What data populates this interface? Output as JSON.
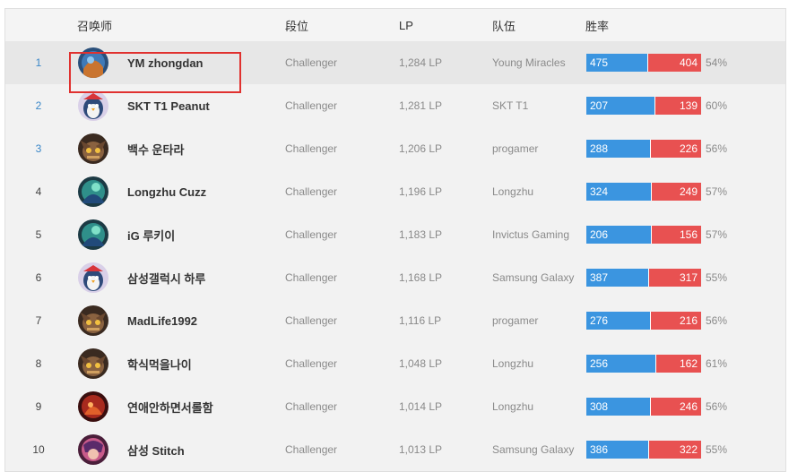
{
  "header": {
    "summoner": "召唤师",
    "tier": "段位",
    "lp": "LP",
    "team": "队伍",
    "winrate": "胜率"
  },
  "colors": {
    "win": "#3b95e0",
    "loss": "#e85151",
    "highlight": "#e0312f",
    "rank_link": "#3a87c8"
  },
  "rows": [
    {
      "rank": "1",
      "avatar": "blue-champion-avatar",
      "name": "YM zhongdan",
      "tier": "Challenger",
      "lp": "1,284 LP",
      "team": "Young Miracles",
      "wins": "475",
      "losses": "404",
      "pct": "54%",
      "win_frac": 0.54
    },
    {
      "rank": "2",
      "avatar": "penguin-avatar",
      "name": "SKT T1 Peanut",
      "tier": "Challenger",
      "lp": "1,281 LP",
      "team": "SKT T1",
      "wins": "207",
      "losses": "139",
      "pct": "60%",
      "win_frac": 0.6
    },
    {
      "rank": "3",
      "avatar": "yordle-avatar",
      "name": "백수 운타라",
      "tier": "Challenger",
      "lp": "1,206 LP",
      "team": "progamer",
      "wins": "288",
      "losses": "226",
      "pct": "56%",
      "win_frac": 0.56
    },
    {
      "rank": "4",
      "avatar": "green-champion-avatar",
      "name": "Longzhu Cuzz",
      "tier": "Challenger",
      "lp": "1,196 LP",
      "team": "Longzhu",
      "wins": "324",
      "losses": "249",
      "pct": "57%",
      "win_frac": 0.57
    },
    {
      "rank": "5",
      "avatar": "green-champion-avatar",
      "name": "iG 루키이",
      "tier": "Challenger",
      "lp": "1,183 LP",
      "team": "Invictus Gaming",
      "wins": "206",
      "losses": "156",
      "pct": "57%",
      "win_frac": 0.57
    },
    {
      "rank": "6",
      "avatar": "penguin-avatar",
      "name": "삼성갤럭시 하루",
      "tier": "Challenger",
      "lp": "1,168 LP",
      "team": "Samsung Galaxy",
      "wins": "387",
      "losses": "317",
      "pct": "55%",
      "win_frac": 0.55
    },
    {
      "rank": "7",
      "avatar": "yordle-avatar",
      "name": "MadLife1992",
      "tier": "Challenger",
      "lp": "1,116 LP",
      "team": "progamer",
      "wins": "276",
      "losses": "216",
      "pct": "56%",
      "win_frac": 0.56
    },
    {
      "rank": "8",
      "avatar": "yordle-avatar",
      "name": "학식먹을나이",
      "tier": "Challenger",
      "lp": "1,048 LP",
      "team": "Longzhu",
      "wins": "256",
      "losses": "162",
      "pct": "61%",
      "win_frac": 0.61
    },
    {
      "rank": "9",
      "avatar": "red-champion-avatar",
      "name": "연애안하면서롤함",
      "tier": "Challenger",
      "lp": "1,014 LP",
      "team": "Longzhu",
      "wins": "308",
      "losses": "246",
      "pct": "56%",
      "win_frac": 0.56
    },
    {
      "rank": "10",
      "avatar": "pink-champion-avatar",
      "name": "삼성 Stitch",
      "tier": "Challenger",
      "lp": "1,013 LP",
      "team": "Samsung Galaxy",
      "wins": "386",
      "losses": "322",
      "pct": "55%",
      "win_frac": 0.55
    }
  ]
}
